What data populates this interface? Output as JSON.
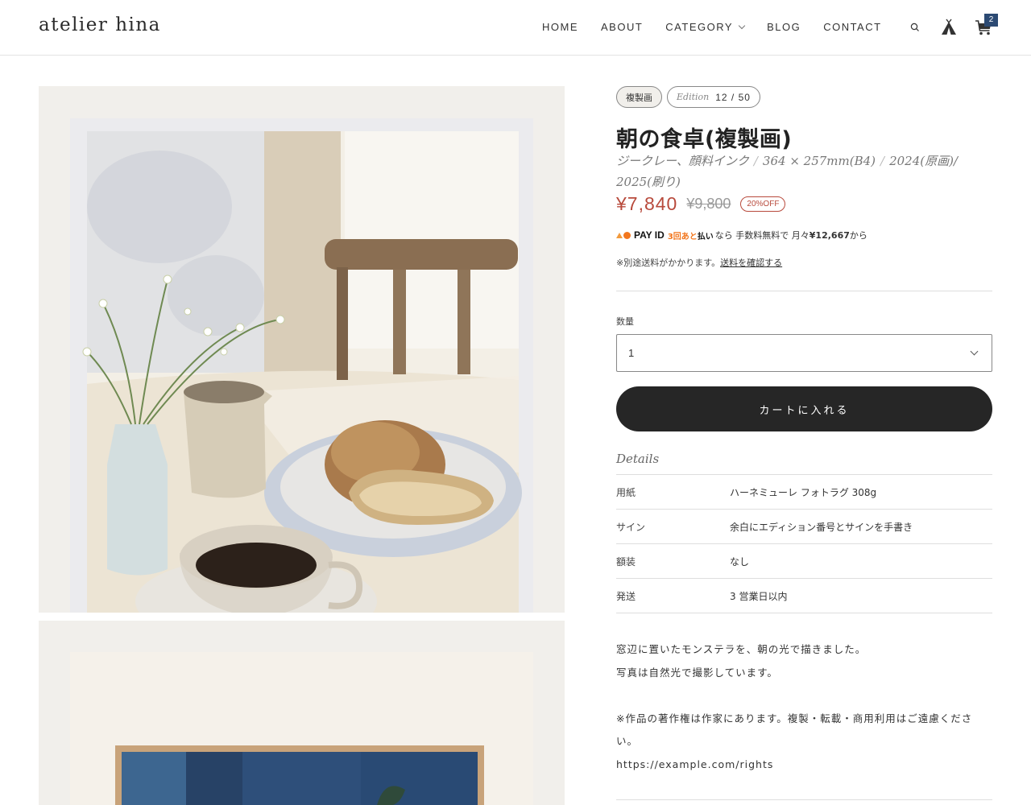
{
  "header": {
    "logo": "atelier hina",
    "nav": [
      "HOME",
      "ABOUT",
      "CATEGORY",
      "BLOG",
      "CONTACT"
    ],
    "cart_count": "2"
  },
  "product": {
    "badge_type": "複製画",
    "edition_label": "Edition",
    "edition_value": "12 / 50",
    "title": "朝の食卓(複製画)",
    "subtitle": {
      "medium": "ジークレー、顔料インク",
      "size": "364 × 257mm(B4)",
      "year": "2024(原画)/ 2025(刷り)"
    },
    "price": "¥7,840",
    "price_original": "¥9,800",
    "discount": "20%OFF",
    "payid": {
      "brand": "PAY ID",
      "later_prefix": "3回あと",
      "later_suffix": "払い",
      "text1": "なら 手数料無料で 月々",
      "amount": "¥12,667",
      "text2": "から"
    },
    "shipping_note": "※別途送料がかかります。",
    "shipping_link": "送料を確認する",
    "quantity_label": "数量",
    "quantity_value": "1",
    "cart_button": "カートに入れる",
    "details_heading": "Details",
    "specs": [
      {
        "label": "用紙",
        "value": "ハーネミューレ フォトラグ 308g"
      },
      {
        "label": "サイン",
        "value": "余白にエディション番号とサインを手書き"
      },
      {
        "label": "額装",
        "value": "なし"
      },
      {
        "label": "発送",
        "value": "3 営業日以内"
      }
    ],
    "description": [
      "窓辺に置いたモンステラを、朝の光で描きました。",
      "写真は自然光で撮影しています。",
      "",
      "※作品の著作権は作家にあります。複製・転載・商用利用はご遠慮ください。",
      "https://example.com/rights"
    ]
  },
  "colors": {
    "accent": "#b84a3c",
    "button": "#262626",
    "badge": "#2c4a73",
    "gallery_bg": "#f1efeb"
  }
}
